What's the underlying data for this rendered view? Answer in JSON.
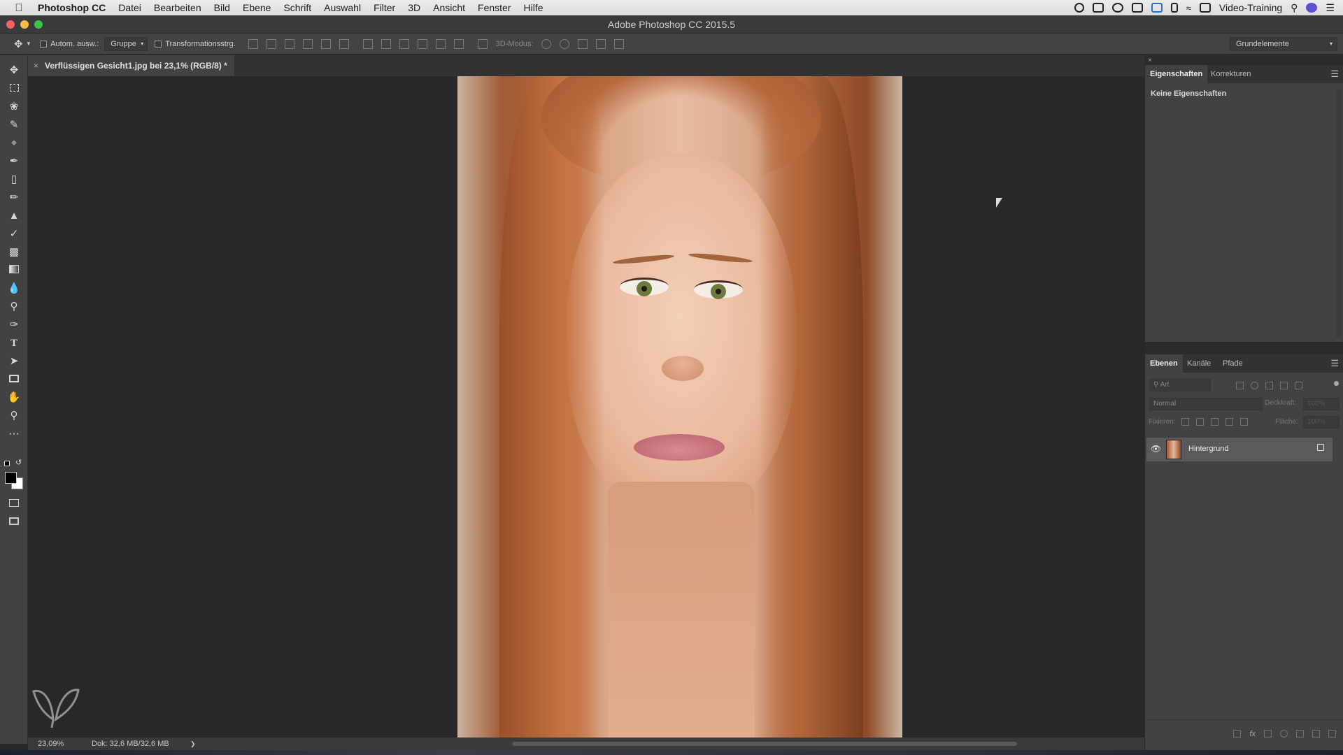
{
  "menubar": {
    "app_name": "Photoshop CC",
    "items": [
      "Datei",
      "Bearbeiten",
      "Bild",
      "Ebene",
      "Schrift",
      "Auswahl",
      "Filter",
      "3D",
      "Ansicht",
      "Fenster",
      "Hilfe"
    ],
    "user": "Video-Training"
  },
  "window": {
    "title": "Adobe Photoshop CC 2015.5"
  },
  "options": {
    "auto_select_label": "Autom. ausw.:",
    "auto_select_value": "Gruppe",
    "transform_label": "Transformationsstrg.",
    "mode_3d_label": "3D-Modus:",
    "workspace": "Grundelemente"
  },
  "document": {
    "tab_title": "Verflüssigen Gesicht1.jpg bei 23,1% (RGB/8) *",
    "close_glyph": "×"
  },
  "status": {
    "zoom": "23,09%",
    "doc_size": "Dok: 32,6 MB/32,6 MB",
    "arrow": "❯"
  },
  "properties_panel": {
    "tabs": [
      "Eigenschaften",
      "Korrekturen"
    ],
    "empty_text": "Keine Eigenschaften"
  },
  "layers_panel": {
    "tabs": [
      "Ebenen",
      "Kanäle",
      "Pfade"
    ],
    "filter_placeholder": "Art",
    "blend_mode": "Normal",
    "opacity_label": "Deckkraft:",
    "opacity_value": "100%",
    "lock_label": "Fixieren:",
    "fill_label": "Fläche:",
    "fill_value": "100%",
    "layers": [
      {
        "name": "Hintergrund",
        "visible": true,
        "locked": true
      }
    ]
  },
  "colors": {
    "accent_close": "#fc605c",
    "accent_min": "#fdbc40",
    "accent_max": "#34c84a"
  }
}
